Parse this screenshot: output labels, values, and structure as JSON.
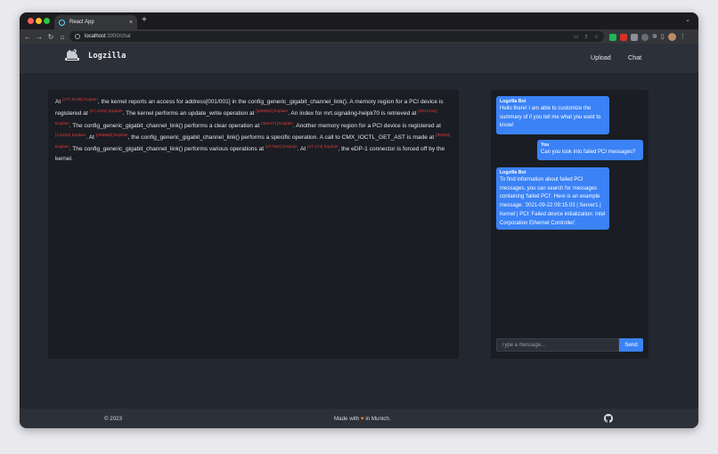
{
  "browser": {
    "tab_title": "React App",
    "tab_close": "×",
    "new_tab": "+",
    "tab_menu": "⌄",
    "url_host": "localhost",
    "url_path": ":3000/chat"
  },
  "app": {
    "brand": "Logzilla",
    "nav": {
      "upload": "Upload",
      "chat": "Chat"
    }
  },
  "log": [
    {
      "text": "At "
    },
    {
      "ts": "[477.5196] Explain"
    },
    {
      "text": ", the kernel reports an access for address[001/001] in the config_generic_gigabit_channel_link(). A memory region for a PCI device is registered at "
    },
    {
      "ts": "[47.1231] Explain"
    },
    {
      "text": ". The kernel performs an update_write operation at "
    },
    {
      "ts": "[469552] Explain"
    },
    {
      "text": ". An index for mrt.signaling-helpk70 is retrieved at "
    },
    {
      "ts": "[4212191] Explain"
    },
    {
      "text": ". The config_generic_gigabit_channel_link() performs a clear operation at "
    },
    {
      "ts": "[482471] Explain"
    },
    {
      "text": ". Another memory region for a PCI device is registered at "
    },
    {
      "ts": "[4,5101] Explain"
    },
    {
      "text": ". At "
    },
    {
      "ts": "[458668] Explain"
    },
    {
      "text": ", the config_generic_gigabit_channel_link() performs a specific operation. A call to CMX_IOCTL_GET_AST is made at "
    },
    {
      "ts": "[88250] Explain"
    },
    {
      "text": ". The config_generic_gigabit_channel_link() performs various operations at "
    },
    {
      "ts": "[477581] Explain"
    },
    {
      "text": ". At "
    },
    {
      "ts": "[47,174] Explain"
    },
    {
      "text": ", the eDP-1 connector is forced off by the kernel."
    }
  ],
  "chat": {
    "messages": [
      {
        "sender": "Logzilla Bot",
        "text": "Hello there! I am able to customize the summary of if you tell me what you want to know!"
      },
      {
        "sender": "You",
        "text": "Can you look into failed PCI messages?"
      },
      {
        "sender": "Logzilla Bot",
        "text": "To find information about failed PCI messages, you can search for messages containing 'failed PCI'. Here is an example message: '2021-09-22 09:15:03 | Server1 | Kernel | PCI: Failed device initialization: Intel Corporation Ethernet Controller'."
      }
    ],
    "input_placeholder": "Type a message...",
    "send_label": "Send"
  },
  "footer": {
    "copyright": "© 2023",
    "made_prefix": "Made with ",
    "heart": "♥",
    "made_suffix": " in Munich."
  },
  "colors": {
    "accent": "#3b82f6",
    "timestamp": "#dc3b3b",
    "panel": "#1a1d23",
    "page": "#23272f",
    "bar": "#2c3039"
  }
}
